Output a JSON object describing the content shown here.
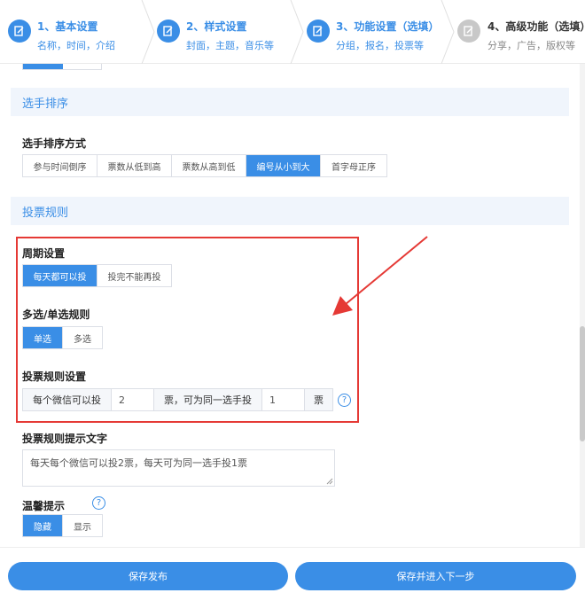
{
  "steps": [
    {
      "title": "1、基本设置",
      "sub": "名称，时间，介绍",
      "active": true
    },
    {
      "title": "2、样式设置",
      "sub": "封面，主题，音乐等",
      "active": true
    },
    {
      "title": "3、功能设置（选填）",
      "sub": "分组，报名，投票等",
      "active": true
    },
    {
      "title": "4、高级功能（选填）",
      "sub": "分享，广告，版权等",
      "active": false
    }
  ],
  "sections": {
    "sort": "选手排序",
    "vote": "投票规则"
  },
  "sort": {
    "label": "选手排序方式",
    "options": [
      "参与时间倒序",
      "票数从低到高",
      "票数从高到低",
      "编号从小到大",
      "首字母正序"
    ],
    "selected": "编号从小到大"
  },
  "period": {
    "label": "周期设置",
    "options": [
      "每天都可以投",
      "投完不能再投"
    ],
    "selected": "每天都可以投"
  },
  "multi": {
    "label": "多选/单选规则",
    "options": [
      "单选",
      "多选"
    ],
    "selected": "单选"
  },
  "rule": {
    "label": "投票规则设置",
    "prefix": "每个微信可以投",
    "value1": "2",
    "middle": "票，可为同一选手投",
    "value2": "1",
    "suffix": "票",
    "help": "?"
  },
  "tip": {
    "label": "投票规则提示文字",
    "text": "每天每个微信可以投2票，每天可为同一选手投1票"
  },
  "warm": {
    "label": "温馨提示",
    "help": "?",
    "options": [
      "隐藏",
      "显示"
    ],
    "selected": "隐藏"
  },
  "buttons": {
    "publish": "保存发布",
    "next": "保存并进入下一步"
  },
  "colors": {
    "accent": "#3a8ee6",
    "highlight_border": "#e53935"
  }
}
